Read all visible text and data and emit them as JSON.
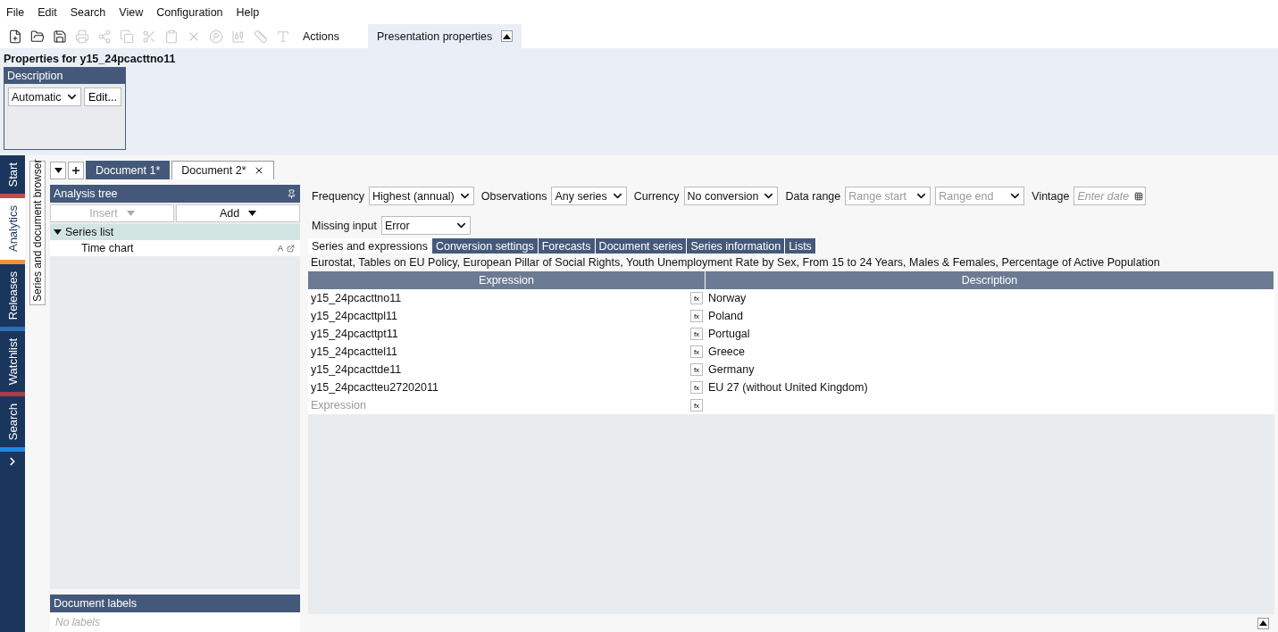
{
  "menu": [
    "File",
    "Edit",
    "Search",
    "View",
    "Configuration",
    "Help"
  ],
  "toolbar": {
    "tools": [
      {
        "disabled": false
      },
      {
        "disabled": false
      },
      {
        "disabled": false
      },
      {
        "disabled": true
      },
      {
        "disabled": true
      },
      {
        "disabled": true
      },
      {
        "disabled": true
      },
      {
        "disabled": true
      },
      {
        "disabled": true
      },
      {
        "disabled": true
      },
      {
        "disabled": true
      },
      {
        "disabled": true
      },
      {
        "disabled": true
      }
    ],
    "actions": "Actions",
    "presentation_tab": {
      "label": "Presentation properties",
      "selected": true,
      "expanded": true
    }
  },
  "properties": {
    "title": "Properties for y15_24pcacttno11",
    "group": "Description",
    "select": "Automatic",
    "button": "Edit..."
  },
  "nav_tabs": [
    {
      "label": "Start",
      "selected": false,
      "color": "#c0504d"
    },
    {
      "label": "Analytics",
      "selected": true,
      "color": "#f39237"
    },
    {
      "label": "Releases",
      "selected": false,
      "color": "#2f6db5"
    },
    {
      "label": "Watchlist",
      "selected": false,
      "color": "#a0404a"
    },
    {
      "label": "Search",
      "selected": false,
      "color": "#1e88e5"
    }
  ],
  "browser_tab": "Series and document browser",
  "documents": [
    {
      "label": "Document 1*",
      "selected": false
    },
    {
      "label": "Document 2*",
      "selected": true
    }
  ],
  "analysis_tree": {
    "title": "Analysis tree",
    "insert": {
      "label": "Insert",
      "disabled": true
    },
    "add": {
      "label": "Add",
      "disabled": false
    },
    "items": [
      {
        "label": "Series list",
        "expanded": true,
        "selected": true,
        "children": [
          {
            "label": "Time chart",
            "selected": false,
            "tag": "A"
          }
        ]
      }
    ]
  },
  "document_labels": {
    "title": "Document labels",
    "placeholder": "No labels"
  },
  "filters": [
    {
      "kind": "select",
      "label": "Frequency",
      "value": "Highest (annual)"
    },
    {
      "kind": "select",
      "label": "Observations",
      "value": "Any series"
    },
    {
      "kind": "select",
      "label": "Currency",
      "value": "No conversion"
    },
    {
      "kind": "range",
      "label": "Data range",
      "start": "Range start",
      "end": "Range end"
    },
    {
      "kind": "date",
      "label": "Vintage",
      "placeholder": "Enter date"
    },
    {
      "kind": "select",
      "label": "Missing input",
      "value": "Error"
    }
  ],
  "subtabs": [
    {
      "label": "Series and expressions",
      "selected": true
    },
    {
      "label": "Conversion settings",
      "selected": false
    },
    {
      "label": "Forecasts",
      "selected": false
    },
    {
      "label": "Document series",
      "selected": false
    },
    {
      "label": "Series information",
      "selected": false
    },
    {
      "label": "Lists",
      "selected": false
    }
  ],
  "series_title": "Eurostat, Tables on EU Policy, European Pillar of Social Rights, Youth Unemployment Rate by Sex, From 15 to 24 Years, Males & Females, Percentage of Active Population",
  "table": {
    "columns": [
      "Expression",
      "Description"
    ],
    "rows": [
      {
        "expression": "y15_24pcacttno11",
        "button": "fx",
        "description": "Norway"
      },
      {
        "expression": "y15_24pcacttpl11",
        "button": "fx",
        "description": "Poland"
      },
      {
        "expression": "y15_24pcacttpt11",
        "button": "fx",
        "description": "Portugal"
      },
      {
        "expression": "y15_24pcacttel11",
        "button": "fx",
        "description": "Greece"
      },
      {
        "expression": "y15_24pcacttde11",
        "button": "fx",
        "description": "Germany"
      },
      {
        "expression": "y15_24pcactteu27202011",
        "button": "fx",
        "description": "EU 27 (without United Kingdom)"
      }
    ],
    "new_row": {
      "placeholder": "Expression",
      "button": "fx"
    }
  }
}
